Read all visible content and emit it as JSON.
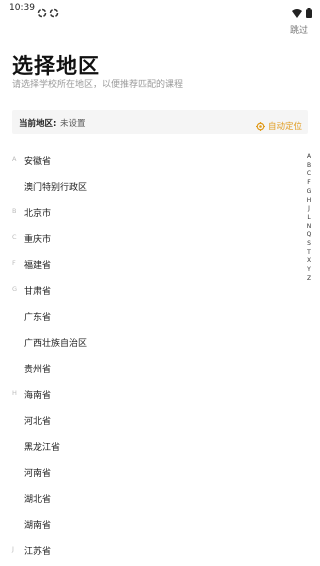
{
  "status": {
    "time": "10:39"
  },
  "header": {
    "skip": "跳过"
  },
  "title": "选择地区",
  "subtitle": "请选择学校所在地区，以便推荐匹配的课程",
  "current": {
    "label": "当前地区:",
    "value": "未设置",
    "locate": "自动定位"
  },
  "colors": {
    "accent": "#e09a1a",
    "muted": "#9a9a9a",
    "card": "#f5f5f5"
  },
  "regions": [
    {
      "letter": "A",
      "name": "安徽省"
    },
    {
      "letter": "",
      "name": "澳门特别行政区"
    },
    {
      "letter": "B",
      "name": "北京市"
    },
    {
      "letter": "C",
      "name": "重庆市"
    },
    {
      "letter": "F",
      "name": "福建省"
    },
    {
      "letter": "G",
      "name": "甘肃省"
    },
    {
      "letter": "",
      "name": "广东省"
    },
    {
      "letter": "",
      "name": "广西壮族自治区"
    },
    {
      "letter": "",
      "name": "贵州省"
    },
    {
      "letter": "H",
      "name": "海南省"
    },
    {
      "letter": "",
      "name": "河北省"
    },
    {
      "letter": "",
      "name": "黑龙江省"
    },
    {
      "letter": "",
      "name": "河南省"
    },
    {
      "letter": "",
      "name": "湖北省"
    },
    {
      "letter": "",
      "name": "湖南省"
    },
    {
      "letter": "J",
      "name": "江苏省"
    }
  ],
  "index": [
    "A",
    "B",
    "C",
    "F",
    "G",
    "H",
    "J",
    "L",
    "N",
    "Q",
    "S",
    "T",
    "X",
    "Y",
    "Z"
  ]
}
